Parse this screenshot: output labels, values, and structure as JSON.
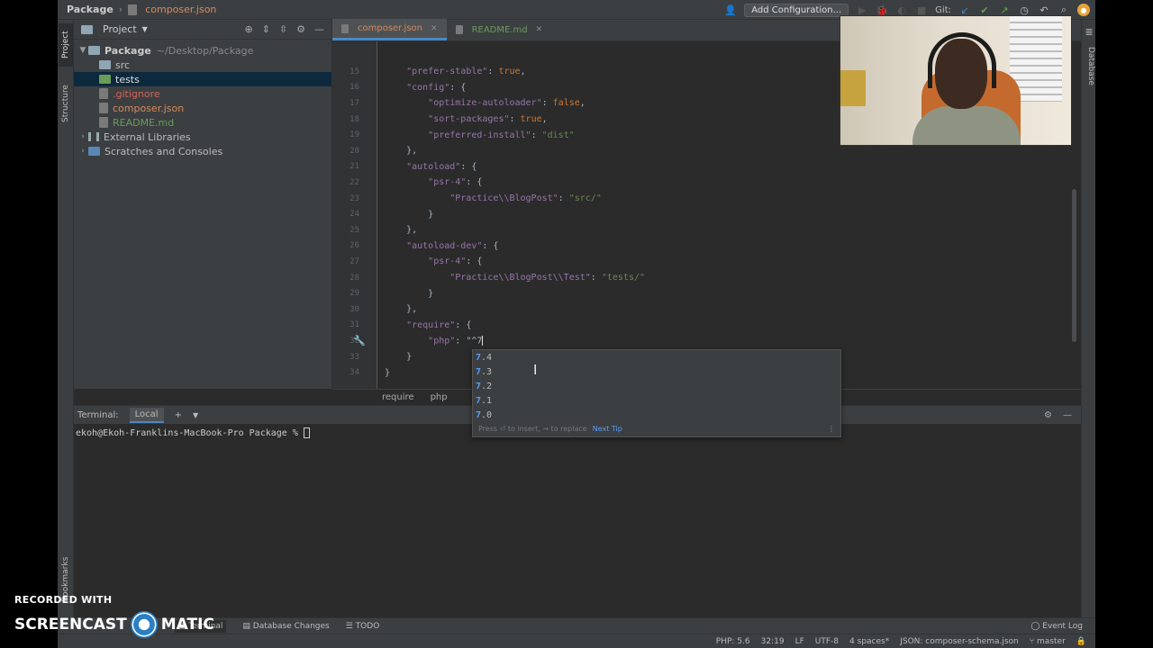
{
  "topbar": {
    "project_name": "Package",
    "current_file": "composer.json",
    "run_config": "Add Configuration...",
    "git_label": "Git:"
  },
  "left_stripe": {
    "project_tab": "Project",
    "structure_tab": "Structure",
    "bookmarks_tab": "Bookmarks"
  },
  "right_stripe": {
    "database_tab": "Database"
  },
  "project_panel": {
    "title": "Project",
    "root_name": "Package",
    "root_path": "~/Desktop/Package",
    "items": [
      {
        "label": "src",
        "kind": "folder"
      },
      {
        "label": "tests",
        "kind": "folder-test"
      },
      {
        "label": ".gitignore",
        "kind": "file-ignored"
      },
      {
        "label": "composer.json",
        "kind": "file-modified"
      },
      {
        "label": "README.md",
        "kind": "file-new"
      }
    ],
    "external_libraries": "External Libraries",
    "scratches": "Scratches and Consoles"
  },
  "tabs": [
    {
      "label": "composer.json"
    },
    {
      "label": "README.md"
    }
  ],
  "editor": {
    "lines": [
      {
        "n": "15",
        "text": "    \"prefer-stable\": true,"
      },
      {
        "n": "16",
        "text": "    \"config\": {"
      },
      {
        "n": "17",
        "text": "        \"optimize-autoloader\": false,"
      },
      {
        "n": "18",
        "text": "        \"sort-packages\": true,"
      },
      {
        "n": "19",
        "text": "        \"preferred-install\": \"dist\""
      },
      {
        "n": "20",
        "text": "    },"
      },
      {
        "n": "21",
        "text": "    \"autoload\": {"
      },
      {
        "n": "22",
        "text": "        \"psr-4\": {"
      },
      {
        "n": "23",
        "text": "            \"Practice\\\\BlogPost\": \"src/\""
      },
      {
        "n": "24",
        "text": "        }"
      },
      {
        "n": "25",
        "text": "    },"
      },
      {
        "n": "26",
        "text": "    \"autoload-dev\": {"
      },
      {
        "n": "27",
        "text": "        \"psr-4\": {"
      },
      {
        "n": "28",
        "text": "            \"Practice\\\\BlogPost\\\\Test\": \"tests/\""
      },
      {
        "n": "29",
        "text": "        }"
      },
      {
        "n": "30",
        "text": "    },"
      },
      {
        "n": "31",
        "text": "    \"require\": {"
      },
      {
        "n": "32",
        "text": "        \"php\": \"^7"
      },
      {
        "n": "33",
        "text": "    }"
      },
      {
        "n": "34",
        "text": "}"
      }
    ],
    "breadcrumb": [
      "require",
      "php"
    ]
  },
  "completion": {
    "items": [
      "7.4",
      "7.3",
      "7.2",
      "7.1",
      "7.0"
    ],
    "typed_prefix": "7",
    "footer_hint": "Press ⏎ to insert, → to replace",
    "next_tip": "Next Tip"
  },
  "terminal": {
    "title": "Terminal:",
    "tab": "Local",
    "prompt": "ekoh@Ekoh-Franklins-MacBook-Pro Package % "
  },
  "bottom_tools": {
    "terminal": "Terminal",
    "database_changes": "Database Changes",
    "todo": "TODO",
    "event_log": "Event Log"
  },
  "statusbar": {
    "php": "PHP: 5.6",
    "position": "32:19",
    "line_sep": "LF",
    "encoding": "UTF-8",
    "indent": "4 spaces*",
    "schema": "JSON: composer-schema.json",
    "branch": "master"
  },
  "watermark": {
    "top": "RECORDED WITH",
    "brand_left": "SCREENCAST",
    "brand_right": "MATIC"
  },
  "colors": {
    "accent": "#4a88c7",
    "keyword": "#9876aa",
    "string": "#6a8759",
    "bool": "#cc7832"
  }
}
